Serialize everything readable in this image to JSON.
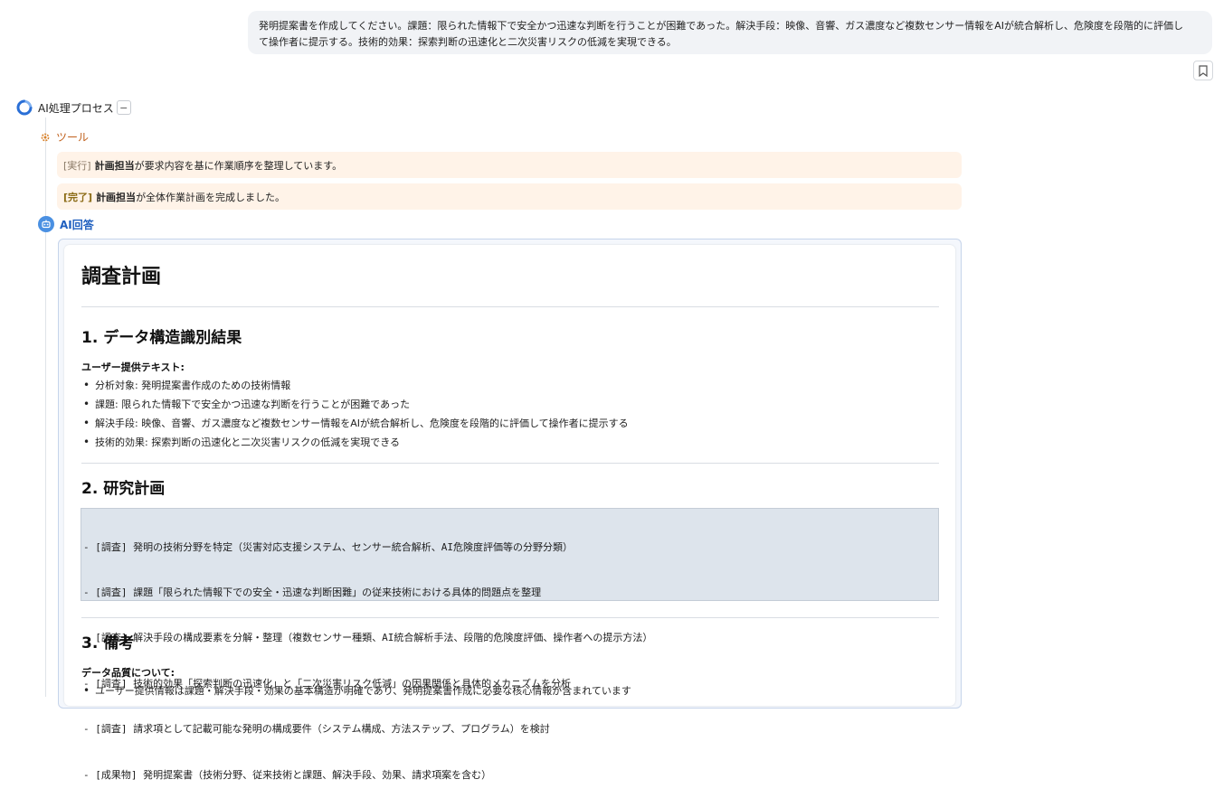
{
  "user_message": {
    "line1": "発明提案書を作成してください。課題：限られた情報下で安全かつ迅速な判断を行うことが困難であった。解決手段：映像、音響、ガス濃度など複数センサー情報をAIが統合解析し、危険度を段階的に評価し",
    "line2": "て操作者に提示する。技術的効果：探索判断の迅速化と二次災害リスクの低減を実現できる。"
  },
  "process": {
    "title": "AI処理プロセス",
    "collapse_symbol": "−",
    "tool_label": "ツール",
    "logs": [
      {
        "tag": "[実行]",
        "actor": "計画担当",
        "text": "が要求内容を基に作業順序を整理しています。"
      },
      {
        "tag": "[完了]",
        "actor": "計画担当",
        "text": "が全体作業計画を完成しました。"
      }
    ],
    "ai_label": "AI回答"
  },
  "answer": {
    "title": "調査計画",
    "sections": [
      {
        "title": "1. データ構造識別結果",
        "sub_label": "ユーザー提供テキスト:",
        "bullets": [
          "分析対象: 発明提案書作成のための技術情報",
          "課題: 限られた情報下で安全かつ迅速な判断を行うことが困難であった",
          "解決手段: 映像、音響、ガス濃度など複数センサー情報をAIが統合解析し、危険度を段階的に評価して操作者に提示する",
          "技術的効果: 探索判断の迅速化と二次災害リスクの低減を実現できる"
        ]
      },
      {
        "title": "2. 研究計画",
        "code_lines": [
          "- [調査] 発明の技術分野を特定（災害対応支援システム、センサー統合解析、AI危険度評価等の分野分類）",
          "- [調査] 課題「限られた情報下での安全・迅速な判断困難」の従来技術における具体的問題点を整理",
          "- [調査] 解決手段の構成要素を分解・整理（複数センサー種類、AI統合解析手法、段階的危険度評価、操作者への提示方法）",
          "- [調査] 技術的効果「探索判断の迅速化」と「二次災害リスク低減」の因果関係と具体的メカニズムを分析",
          "- [調査] 請求項として記載可能な発明の構成要件（システム構成、方法ステップ、プログラム）を検討",
          "- [成果物] 発明提案書（技術分野、従来技術と課題、解決手段、効果、請求項案を含む）"
        ]
      },
      {
        "title": "3. 備考",
        "sub_label": "データ品質について:",
        "bullets": [
          "ユーザー提供情報は課題・解決手段・効果の基本構造が明確であり、発明提案書作成に必要な核心情報が含まれています"
        ]
      }
    ]
  },
  "icons": {
    "ai_process": "ai-process-spinner-icon",
    "tool": "gear-icon",
    "ai_answer": "robot-icon",
    "bookmark": "bookmark-icon"
  },
  "colors": {
    "accent_blue": "#1f5fbf",
    "tool_orange": "#c0601c",
    "log_bg": "#fff3e8",
    "code_bg": "#dde4ec"
  }
}
